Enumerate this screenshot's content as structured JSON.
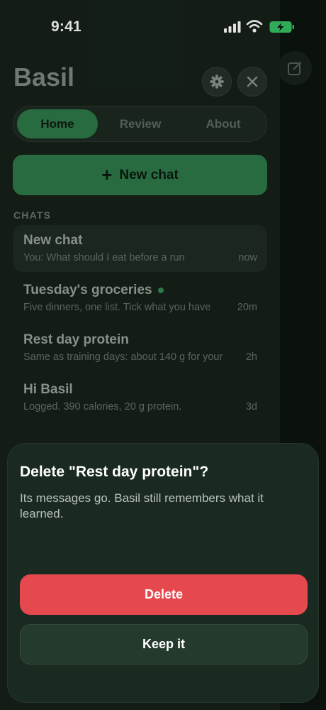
{
  "status_bar": {
    "time": "9:41"
  },
  "drawer": {
    "app_title": "Basil",
    "tabs": [
      {
        "label": "Home",
        "active": true
      },
      {
        "label": "Review",
        "active": false
      },
      {
        "label": "About",
        "active": false
      }
    ],
    "new_chat_label": "New chat",
    "chats_header": "CHATS",
    "chats": [
      {
        "title": "New chat",
        "preview": "You: What should I eat before a run",
        "time": "now",
        "selected": true,
        "unread": false
      },
      {
        "title": "Tuesday's groceries",
        "preview": "Five dinners, one list. Tick what you have",
        "time": "20m",
        "selected": false,
        "unread": true
      },
      {
        "title": "Rest day protein",
        "preview": "Same as training days: about 140 g for your",
        "time": "2h",
        "selected": false,
        "unread": false
      },
      {
        "title": "Hi Basil",
        "preview": "Logged. 390 calories, 20 g protein.",
        "time": "3d",
        "selected": false,
        "unread": false
      }
    ]
  },
  "sheet": {
    "title": "Delete \"Rest day protein\"?",
    "body": "Its messages go. Basil still remembers what it learned.",
    "delete_label": "Delete",
    "keep_label": "Keep it"
  },
  "colors": {
    "accent": "#2f7a49",
    "destructive": "#e5484d",
    "unread_dot": "#2f8a52"
  },
  "icons": [
    "signal-icon",
    "wifi-icon",
    "battery-charging-icon",
    "gear-icon",
    "close-icon",
    "compose-icon",
    "plus-icon"
  ]
}
